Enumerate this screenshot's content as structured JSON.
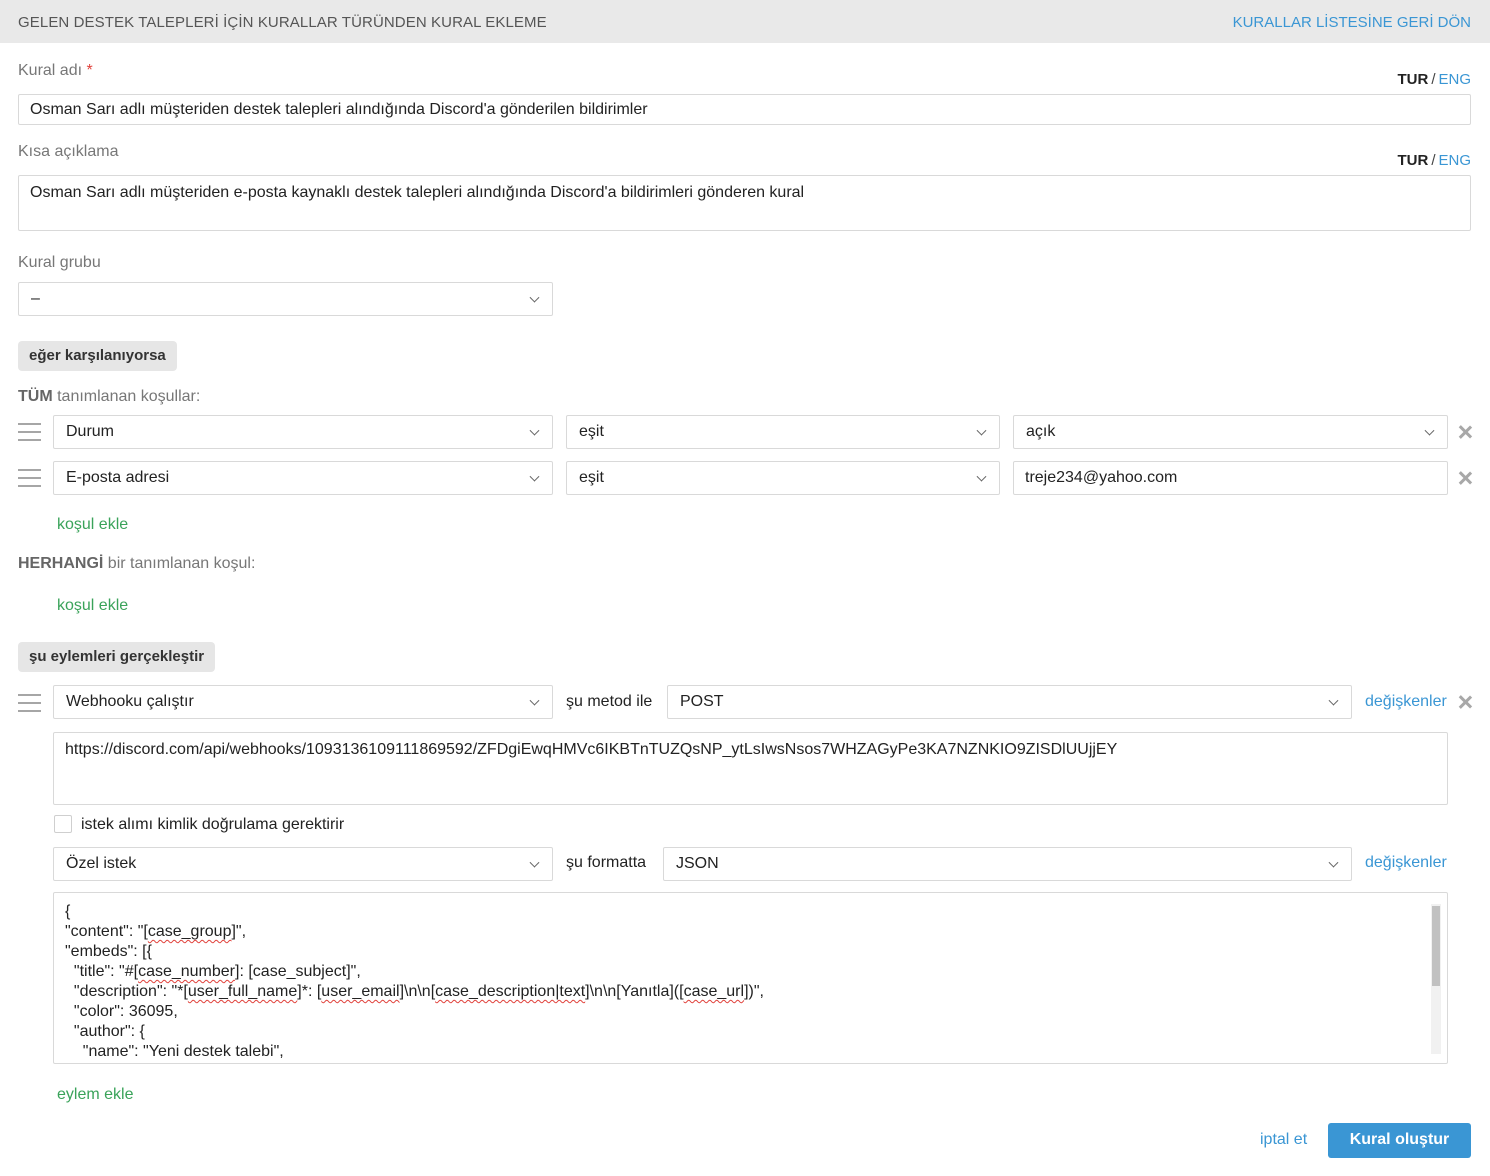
{
  "header": {
    "title": "GELEN DESTEK TALEPLERİ İÇİN KURALLAR TÜRÜNDEN KURAL EKLEME",
    "back_link": "KURALLAR LİSTESİNE GERİ DÖN"
  },
  "rule_name": {
    "label": "Kural adı",
    "required_mark": "*",
    "lang_active": "TUR",
    "lang_sep": "/",
    "lang_other": "ENG",
    "value": "Osman Sarı adlı müşteriden destek talepleri alındığında Discord'a gönderilen bildirimler"
  },
  "short_description": {
    "label": "Kısa açıklama",
    "lang_active": "TUR",
    "lang_sep": "/",
    "lang_other": "ENG",
    "value": "Osman Sarı adlı müşteriden e-posta kaynaklı destek talepleri alındığında Discord'a bildirimleri gönderen kural"
  },
  "rule_group": {
    "label": "Kural grubu",
    "value": "–"
  },
  "conditions": {
    "section_label": "eğer karşılanıyorsa",
    "all_label_bold": "TÜM",
    "all_label_rest": " tanımlanan koşullar:",
    "rows": [
      {
        "field": "Durum",
        "operator": "eşit",
        "value": "açık"
      },
      {
        "field": "E-posta adresi",
        "operator": "eşit",
        "value": "treje234@yahoo.com"
      }
    ],
    "add_condition": "koşul ekle",
    "any_label_bold": "HERHANGİ",
    "any_label_rest": " bir tanımlanan koşul:",
    "add_condition_any": "koşul ekle"
  },
  "actions": {
    "section_label": "şu eylemleri gerçekleştir",
    "action_type": "Webhooku çalıştır",
    "method_label": "şu metod ile",
    "method": "POST",
    "variables_link": "değişkenler",
    "url": "https://discord.com/api/webhooks/1093136109111869592/ZFDgiEwqHMVc6IKBTnTUZQsNP_ytLsIwsNsos7WHZAGyPe3KA7NZNKIO9ZISDlUUjjEY",
    "auth_checkbox_label": "istek alımı kimlik doğrulama gerektirir",
    "auth_checked": false,
    "request_type": "Özel istek",
    "format_label": "şu formatta",
    "format": "JSON",
    "variables_link_2": "değişkenler",
    "body_lines": [
      "{",
      "\"content\": \"[case_group]\",",
      "\"embeds\": [{",
      "  \"title\": \"#[case_number]: [case_subject]\",",
      "  \"description\": \"*[user_full_name]*: [user_email]\\n\\n[case_description|text]\\n\\n[Yanıtla]([case_url])\",",
      "  \"color\": 36095,",
      "  \"author\": {",
      "    \"name\": \"Yeni destek talebi\","
    ],
    "add_action": "eylem ekle"
  },
  "footer": {
    "cancel": "iptal et",
    "submit": "Kural oluştur"
  },
  "colors": {
    "accent": "#3a96d4",
    "green_link": "#3aa35a",
    "required": "#e0403a",
    "header_bg": "#e9e9e9"
  }
}
